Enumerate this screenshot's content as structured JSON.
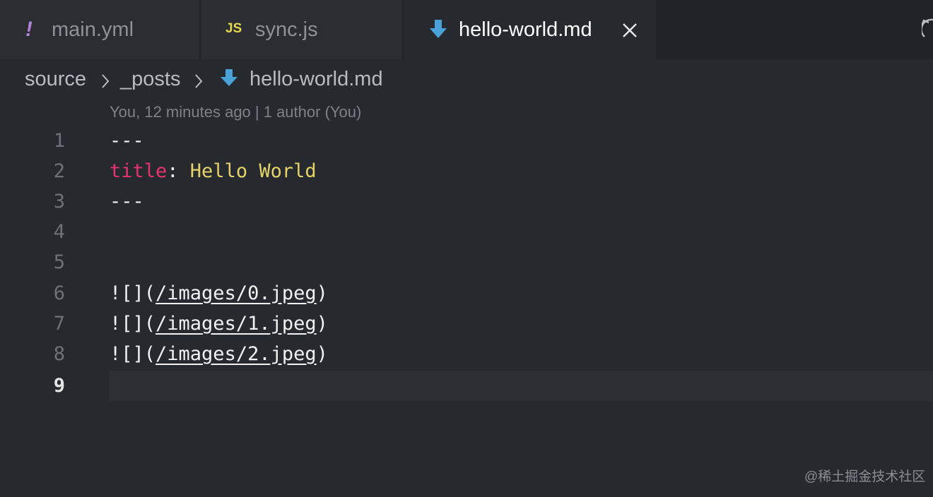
{
  "tabs": [
    {
      "label": "main.yml",
      "icon": "yaml-exclamation-icon",
      "icon_glyph": "!"
    },
    {
      "label": "sync.js",
      "icon": "javascript-file-icon",
      "icon_glyph": "JS"
    },
    {
      "label": "hello-world.md",
      "icon": "markdown-download-icon",
      "active": true
    }
  ],
  "breadcrumb": [
    "source",
    "_posts",
    "hello-world.md"
  ],
  "blame": "You, 12 minutes ago | 1 author (You)",
  "lines": [
    {
      "num": "1",
      "text": "---"
    },
    {
      "num": "2",
      "key": "title",
      "colon": ":",
      "value": " Hello World"
    },
    {
      "num": "3",
      "text": "---"
    },
    {
      "num": "4",
      "text": ""
    },
    {
      "num": "5",
      "text": ""
    },
    {
      "num": "6",
      "prefix": "![](",
      "link": "/images/0.jpeg",
      "suffix": ")"
    },
    {
      "num": "7",
      "prefix": "![](",
      "link": "/images/1.jpeg",
      "suffix": ")"
    },
    {
      "num": "8",
      "prefix": "![](",
      "link": "/images/2.jpeg",
      "suffix": ")"
    },
    {
      "num": "9",
      "text": "",
      "current": true
    }
  ],
  "watermark": "@稀土掘金技术社区",
  "colors": {
    "background": "#262a2f",
    "yaml_key": "#e8336d",
    "yaml_value": "#e5d36a",
    "markdown_icon": "#4aa3d8",
    "js_icon": "#e6d74c",
    "yaml_icon": "#b180d7"
  }
}
